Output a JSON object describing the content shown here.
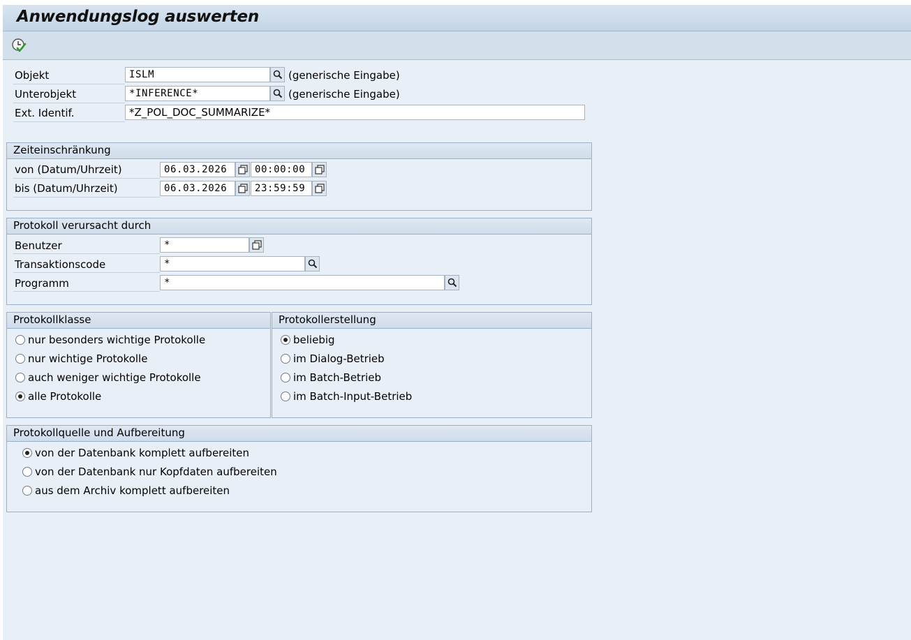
{
  "title": "Anwendungslog auswerten",
  "toolbar": {
    "execute_icon": "execute-clock-check-icon"
  },
  "selection": {
    "objekt": {
      "label": "Objekt",
      "value": "ISLM",
      "hint": "(generische Eingabe)"
    },
    "unterobjekt": {
      "label": "Unterobjekt",
      "value": "*INFERENCE*",
      "hint": "(generische Eingabe)"
    },
    "ext_identif": {
      "label": "Ext. Identif.",
      "value": "*Z_POL_DOC_SUMMARIZE*"
    }
  },
  "zeit": {
    "title": "Zeiteinschränkung",
    "von": {
      "label": "von (Datum/Uhrzeit)",
      "date": "06.03.2026",
      "time": "00:00:00"
    },
    "bis": {
      "label": "bis (Datum/Uhrzeit)",
      "date": "06.03.2026",
      "time": "23:59:59"
    }
  },
  "verursacht": {
    "title": "Protokoll verursacht durch",
    "benutzer": {
      "label": "Benutzer",
      "value": "*"
    },
    "tcode": {
      "label": "Transaktionscode",
      "value": "*"
    },
    "programm": {
      "label": "Programm",
      "value": "*"
    }
  },
  "klasse": {
    "title": "Protokollklasse",
    "options": [
      {
        "label": "nur besonders wichtige Protokolle",
        "selected": false
      },
      {
        "label": "nur wichtige Protokolle",
        "selected": false
      },
      {
        "label": "auch weniger wichtige Protokolle",
        "selected": false
      },
      {
        "label": "alle Protokolle",
        "selected": true
      }
    ]
  },
  "erstellung": {
    "title": "Protokollerstellung",
    "options": [
      {
        "label": "beliebig",
        "selected": true
      },
      {
        "label": "im Dialog-Betrieb",
        "selected": false
      },
      {
        "label": "im Batch-Betrieb",
        "selected": false
      },
      {
        "label": "im Batch-Input-Betrieb",
        "selected": false
      }
    ]
  },
  "quelle": {
    "title": "Protokollquelle und Aufbereitung",
    "options": [
      {
        "label": "von der Datenbank komplett aufbereiten",
        "selected": true
      },
      {
        "label": "von der Datenbank nur Kopfdaten aufbereiten",
        "selected": false
      },
      {
        "label": "aus dem Archiv komplett aufbereiten",
        "selected": false
      }
    ]
  },
  "colors": {
    "background": "#e9eff6",
    "title_bar": "#c4d5e6",
    "group_border": "#9ab0c8"
  }
}
